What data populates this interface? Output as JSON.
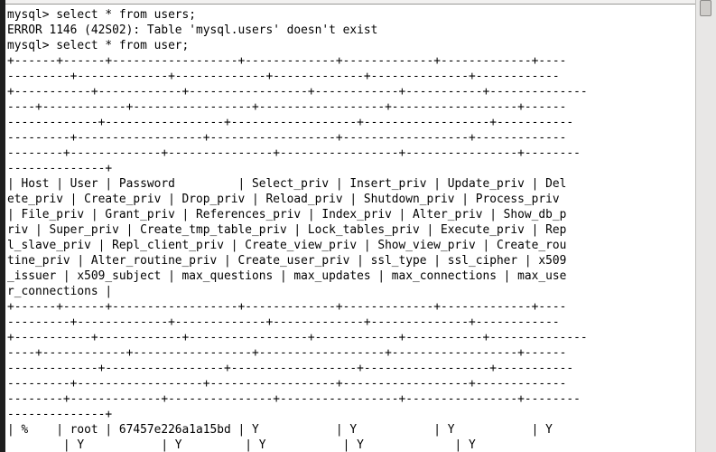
{
  "terminal": {
    "lines": [
      "mysql> select * from users;",
      "ERROR 1146 (42S02): Table 'mysql.users' doesn't exist",
      "mysql> select * from user;",
      "+------+------+------------------+-------------+-------------+-------------+----",
      "---------+-------------+-------------+-------------+--------------+------------",
      "+-----------+------------+-----------------+------------+-----------+--------------",
      "----+------------+-----------------+------------------+------------------+------",
      "-------------+-----------------+------------------+------------------+-----------",
      "---------+------------------+------------------+------------------+-------------",
      "--------+-------------+---------------+-----------------+----------------+--------",
      "--------------+",
      "| Host | User | Password         | Select_priv | Insert_priv | Update_priv | Del",
      "ete_priv | Create_priv | Drop_priv | Reload_priv | Shutdown_priv | Process_priv",
      "| File_priv | Grant_priv | References_priv | Index_priv | Alter_priv | Show_db_p",
      "riv | Super_priv | Create_tmp_table_priv | Lock_tables_priv | Execute_priv | Rep",
      "l_slave_priv | Repl_client_priv | Create_view_priv | Show_view_priv | Create_rou",
      "tine_priv | Alter_routine_priv | Create_user_priv | ssl_type | ssl_cipher | x509",
      "_issuer | x509_subject | max_questions | max_updates | max_connections | max_use",
      "r_connections |",
      "+------+------+------------------+-------------+-------------+-------------+----",
      "---------+-------------+-------------+-------------+--------------+------------",
      "+-----------+------------+-----------------+------------+-----------+--------------",
      "----+------------+-----------------+------------------+------------------+------",
      "-------------+-----------------+------------------+------------------+-----------",
      "---------+------------------+------------------+------------------+-------------",
      "--------+-------------+---------------+-----------------+----------------+--------",
      "--------------+",
      "| %    | root | 67457e226a1a15bd | Y           | Y           | Y           | Y",
      "        | Y           | Y         | Y           | Y             | Y"
    ]
  }
}
